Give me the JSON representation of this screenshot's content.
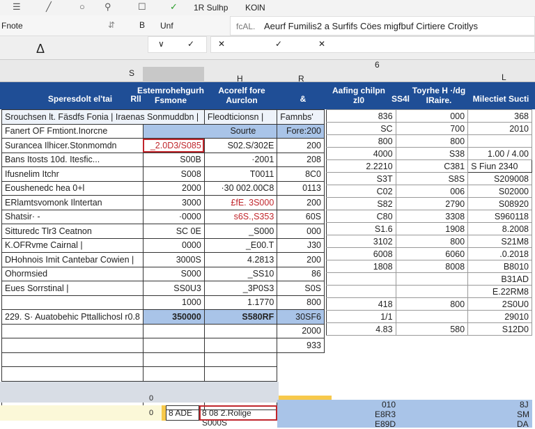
{
  "toolbar": {
    "icons": [
      "menu-icon",
      "pen-icon",
      "circle-icon",
      "pin-icon",
      "square-icon",
      "check-icon"
    ],
    "label1": "1R Sulhp",
    "label2": "KOlN"
  },
  "ribbon": {
    "font_name": "Fnote",
    "bold": "B",
    "style": "Unf",
    "formula_label": "fcAL.",
    "formula_text": "Aeurf Fumilis2 a Surfifs Cöes migfbuf Cirtiere Croitlys"
  },
  "formula_bar": {
    "cancel": "✕",
    "confirm": "✓",
    "cancel2": "✕",
    "name_box_marker": "Δ"
  },
  "col_headers": [
    "S",
    "H",
    "R",
    "6",
    "L"
  ],
  "header": {
    "c1": "Speresdolt el'tai",
    "c2": "Rll",
    "c3": "Estemrohehgurh Fsmone",
    "c4": "Acorelf fore Aurclon",
    "c5": "&",
    "c6": "Aafing chilpn zl0",
    "c7": "SS4l",
    "c8": "Toyrhe H ·/dg IRaire.",
    "c9": "Milectiet Sucti"
  },
  "left_table": {
    "row1": [
      "Srouchsen lt. Fäsdfs Fonia | Iraenas Sonmuddbn |",
      "Fleodticionsn |",
      "Famnbs'"
    ],
    "row2": [
      "Fanert OF Fmtiont.Inorcne",
      "Sourte",
      "Fore:200"
    ],
    "rows": [
      [
        "Surancea Ilhicer.Stonmomdn",
        "_2.0D3/S085",
        "S02.S/302E",
        "200"
      ],
      [
        "Bans Itosts 10d. Itesfic...",
        "S00B",
        "·2001",
        "208"
      ],
      [
        "Ifusnelim Itchr",
        "S008",
        "T0011",
        "8C0"
      ],
      [
        "Eoushenedc hea 0+l",
        "2000",
        "·30 002.00C8",
        "0113"
      ],
      [
        "ERlamtsvomonk Ilntertan",
        "3000",
        "£fE. 3S000",
        "200"
      ],
      [
        "Shatsir· -",
        "·0000",
        "s6S.,S353",
        "60S"
      ],
      [
        "Sitturedc Tlr3 Ceatnon",
        "SC 0E",
        "_S000",
        "000"
      ],
      [
        "K.OFRvme Cairnal |",
        "0000",
        "_E00.T",
        "J30"
      ],
      [
        "DHohnois Imit Cantebar Cowien |",
        "3000S",
        "4.2813",
        "200"
      ],
      [
        "Ohormsied",
        "S000",
        "_SS10",
        "86"
      ],
      [
        "Eues  Sorrstinal |",
        "SS0U3",
        "_3P0S3",
        "S0S"
      ],
      [
        "",
        "1000",
        "1.1770",
        "800"
      ]
    ],
    "total": [
      "229. S· Auatobehic Pttallichosl r0.8",
      "350000",
      "S580RF",
      "30SF6"
    ]
  },
  "right_table": [
    [
      "836",
      "000",
      "368"
    ],
    [
      "SC",
      "700",
      "2010"
    ],
    [
      "800",
      "800",
      ""
    ],
    [
      "4000",
      "S38",
      "1.00 / 4.00"
    ],
    [
      "2.2210",
      "C381",
      "S  Fiun  2340"
    ],
    [
      "S3T",
      "S8S",
      "S209008"
    ],
    [
      "C02",
      "006",
      "S02000"
    ],
    [
      "S82",
      "2790",
      "S08920"
    ],
    [
      "C80",
      "3308",
      "S960118"
    ],
    [
      "S1.6",
      "1908",
      "8.2008"
    ],
    [
      "3102",
      "800",
      "S21M8"
    ],
    [
      "6008",
      "6060",
      ".0.2018"
    ],
    [
      "1808",
      "8008",
      "B8010"
    ],
    [
      "",
      "",
      "B31AD"
    ],
    [
      "",
      "",
      "E.22RM8"
    ],
    [
      "418",
      "800",
      "2S0U0"
    ],
    [
      "1/1",
      "",
      "29010"
    ],
    [
      "4.83",
      "580",
      "S12D0"
    ]
  ],
  "right_leftcol": [
    "2000",
    "933"
  ],
  "bottom": {
    "row_num1": "0",
    "row_num2": "0",
    "cell_a": "8 ADE",
    "cell_b": "8 08 2.Rolige S000S",
    "vals": [
      "010",
      "E8R3",
      "E89D"
    ],
    "vals_right": [
      "8J",
      "SM",
      "DA"
    ]
  },
  "colors": {
    "header_blue": "#1f4e96",
    "light_blue": "#a9c4e8",
    "accent_red": "#c0262c",
    "yellow": "#f7c94b"
  }
}
